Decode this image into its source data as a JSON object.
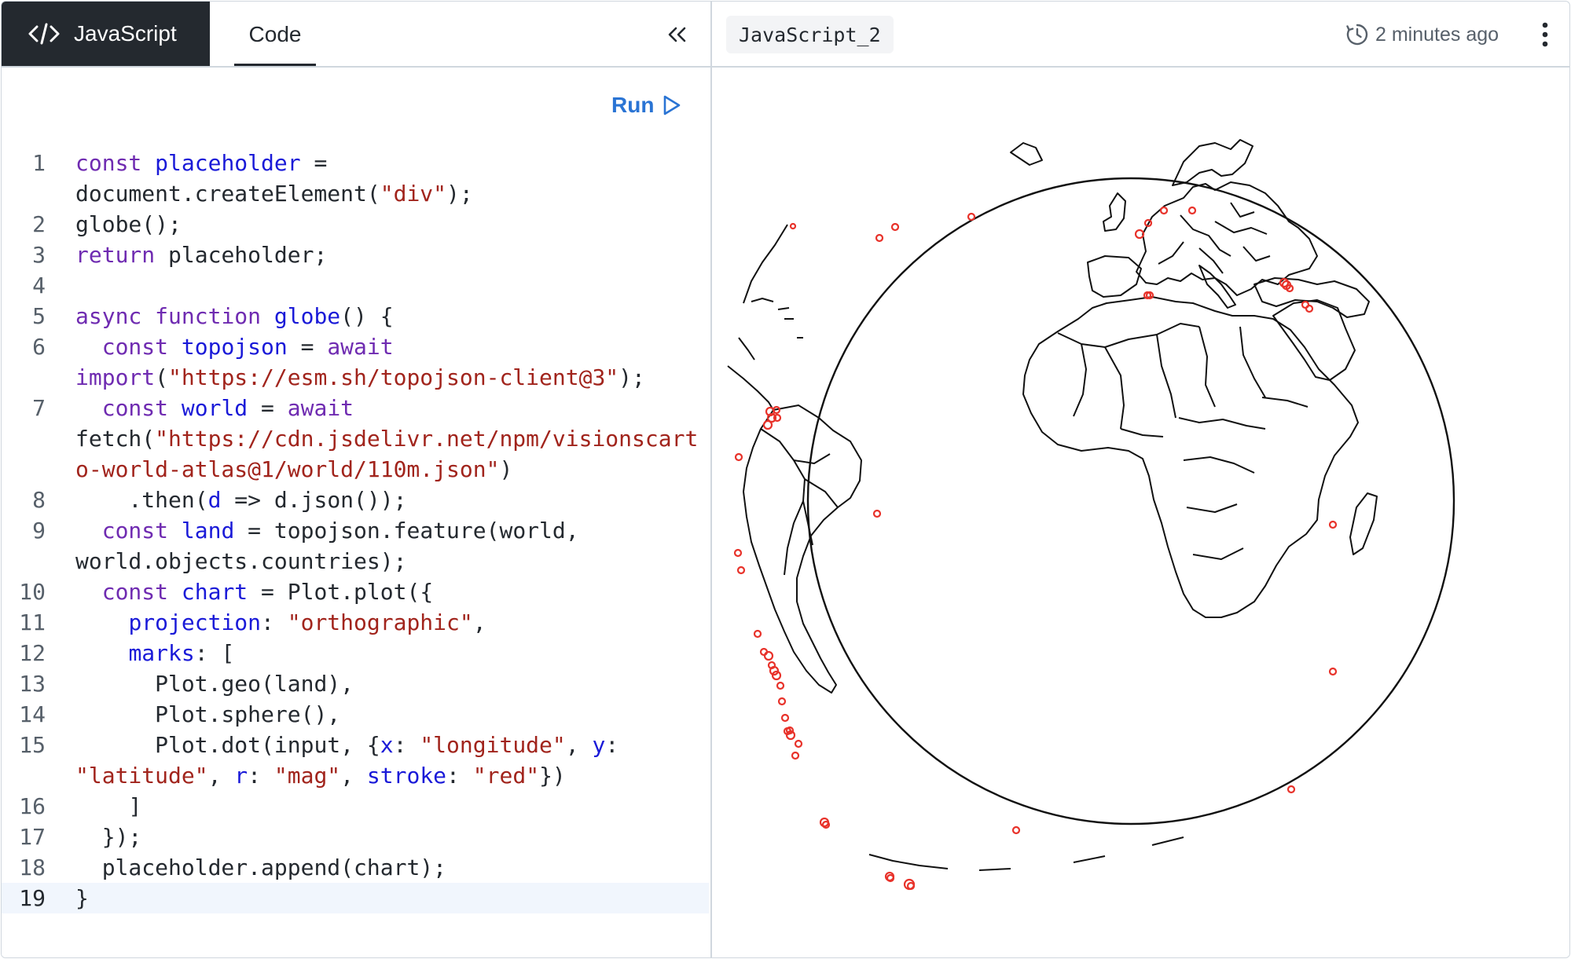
{
  "tabs": {
    "active_label": "JavaScript",
    "code_label": "Code"
  },
  "editor": {
    "run_label": "Run",
    "lines": [
      {
        "n": "1",
        "html": "<span class=\"kw\">const</span> <span class=\"fn\">placeholder</span> =\ndocument.createElement(<span class=\"str\">\"div\"</span>);"
      },
      {
        "n": "2",
        "html": "globe();"
      },
      {
        "n": "3",
        "html": "<span class=\"kw\">return</span> placeholder;"
      },
      {
        "n": "4",
        "html": " "
      },
      {
        "n": "5",
        "html": "<span class=\"kw\">async</span> <span class=\"kw\">function</span> <span class=\"fn\">globe</span>() {"
      },
      {
        "n": "6",
        "html": "  <span class=\"kw\">const</span> <span class=\"fn\">topojson</span> = <span class=\"kw\">await</span>\n<span class=\"kw\">import</span>(<span class=\"str\">\"https://esm.sh/topojson-client@3\"</span>);"
      },
      {
        "n": "7",
        "html": "  <span class=\"kw\">const</span> <span class=\"fn\">world</span> = <span class=\"kw\">await</span>\nfetch(<span class=\"str\">\"https://cdn.jsdelivr.net/npm/visionscart\no-world-atlas@1/world/110m.json\"</span>)"
      },
      {
        "n": "8",
        "html": "    .then(<span class=\"fn\">d</span> => d.json());"
      },
      {
        "n": "9",
        "html": "  <span class=\"kw\">const</span> <span class=\"fn\">land</span> = topojson.feature(world,\nworld.objects.countries);"
      },
      {
        "n": "10",
        "html": "  <span class=\"kw\">const</span> <span class=\"fn\">chart</span> = Plot.plot({"
      },
      {
        "n": "11",
        "html": "    <span class=\"fn\">projection</span>: <span class=\"str\">\"orthographic\"</span>,"
      },
      {
        "n": "12",
        "html": "    <span class=\"fn\">marks</span>: ["
      },
      {
        "n": "13",
        "html": "      Plot.geo(land),"
      },
      {
        "n": "14",
        "html": "      Plot.sphere(),"
      },
      {
        "n": "15",
        "html": "      Plot.dot(input, {<span class=\"fn\">x</span>: <span class=\"str\">\"longitude\"</span>, <span class=\"fn\">y</span>:\n<span class=\"str\">\"latitude\"</span>, <span class=\"fn\">r</span>: <span class=\"str\">\"mag\"</span>, <span class=\"fn\">stroke</span>: <span class=\"str\">\"red\"</span>})"
      },
      {
        "n": "16",
        "html": "    ]"
      },
      {
        "n": "17",
        "html": "  });"
      },
      {
        "n": "18",
        "html": "  placeholder.append(chart);"
      },
      {
        "n": "19",
        "html": "}"
      }
    ],
    "active_line": "19"
  },
  "output": {
    "doc_name": "JavaScript_2",
    "timestamp": "2 minutes ago"
  },
  "icons": {
    "code_tab_icon": "code-brackets-icon",
    "collapse_icon": "double-chevron-left-icon",
    "run_icon": "play-triangle-icon",
    "clock_icon": "clock-icon",
    "menu_icon": "kebab-menu-icon"
  },
  "colors": {
    "dot_stroke": "#e8322a",
    "active_tab_bg": "#24292f",
    "run_blue": "#2a74d4"
  }
}
